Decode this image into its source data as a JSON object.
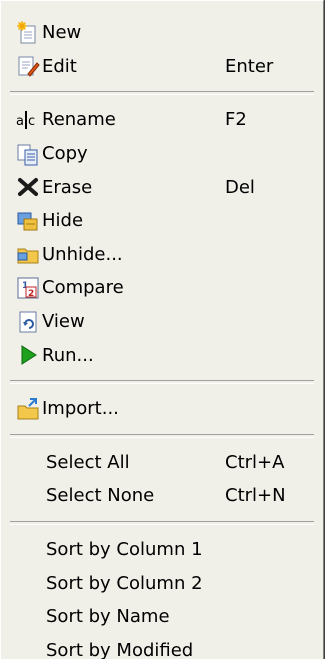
{
  "menu": {
    "group1": [
      {
        "label": "New",
        "shortcut": "",
        "icon": "new-icon"
      },
      {
        "label": "Edit",
        "shortcut": "Enter",
        "icon": "edit-icon"
      }
    ],
    "group2": [
      {
        "label": "Rename",
        "shortcut": "F2",
        "icon": "rename-icon"
      },
      {
        "label": "Copy",
        "shortcut": "",
        "icon": "copy-icon"
      },
      {
        "label": "Erase",
        "shortcut": "Del",
        "icon": "erase-icon"
      },
      {
        "label": "Hide",
        "shortcut": "",
        "icon": "hide-icon"
      },
      {
        "label": "Unhide...",
        "shortcut": "",
        "icon": "unhide-icon"
      },
      {
        "label": "Compare",
        "shortcut": "",
        "icon": "compare-icon"
      },
      {
        "label": "View",
        "shortcut": "",
        "icon": "view-icon"
      },
      {
        "label": "Run...",
        "shortcut": "",
        "icon": "run-icon"
      }
    ],
    "group3": [
      {
        "label": "Import...",
        "shortcut": "",
        "icon": "import-icon"
      }
    ],
    "group4": [
      {
        "label": "Select All",
        "shortcut": "Ctrl+A"
      },
      {
        "label": "Select None",
        "shortcut": "Ctrl+N"
      }
    ],
    "group5": [
      {
        "label": "Sort by Column 1"
      },
      {
        "label": "Sort by Column 2"
      },
      {
        "label": "Sort by Name"
      },
      {
        "label": "Sort by Modified"
      }
    ]
  },
  "colors": {
    "menu_background": "#f0efe8",
    "separator": "#a0a0a0",
    "run_arrow": "#1ea01e"
  }
}
